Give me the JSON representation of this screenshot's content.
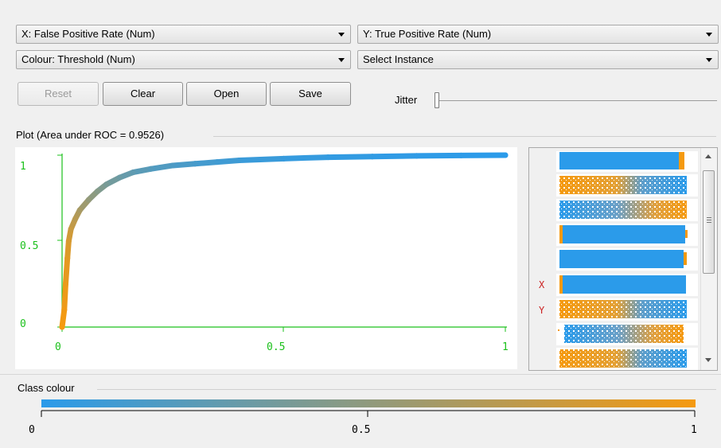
{
  "controls": {
    "x_axis": "X: False Positive Rate (Num)",
    "y_axis": "Y: True Positive Rate (Num)",
    "colour": "Colour: Threshold (Num)",
    "instance": "Select Instance",
    "reset": "Reset",
    "clear": "Clear",
    "open": "Open",
    "save": "Save",
    "jitter": "Jitter"
  },
  "plot": {
    "title": "Plot (Area under ROC = 0.9526)",
    "x_ticks": [
      "0",
      "0.5",
      "1"
    ],
    "y_ticks": [
      "0",
      "0.5",
      "1"
    ]
  },
  "side_panel": {
    "x_marker": "X",
    "y_marker": "Y"
  },
  "class_colour": {
    "title": "Class colour",
    "ticks": [
      "0",
      "0.5",
      "1"
    ],
    "gradient_start": "#2b9bea",
    "gradient_end": "#f59a10"
  },
  "chart_data": {
    "type": "scatter",
    "title": "Plot (Area under ROC = 0.9526)",
    "xlabel": "False Positive Rate",
    "ylabel": "True Positive Rate",
    "xlim": [
      0,
      1
    ],
    "ylim": [
      0,
      1
    ],
    "colour_by": "Threshold",
    "points": [
      [
        0.0,
        0.0
      ],
      [
        0.005,
        0.1
      ],
      [
        0.008,
        0.25
      ],
      [
        0.012,
        0.4
      ],
      [
        0.015,
        0.5
      ],
      [
        0.02,
        0.57
      ],
      [
        0.03,
        0.63
      ],
      [
        0.04,
        0.68
      ],
      [
        0.06,
        0.74
      ],
      [
        0.08,
        0.79
      ],
      [
        0.1,
        0.83
      ],
      [
        0.13,
        0.87
      ],
      [
        0.16,
        0.9
      ],
      [
        0.2,
        0.92
      ],
      [
        0.25,
        0.94
      ],
      [
        0.3,
        0.95
      ],
      [
        0.35,
        0.96
      ],
      [
        0.4,
        0.97
      ],
      [
        0.5,
        0.98
      ],
      [
        0.6,
        0.988
      ],
      [
        0.7,
        0.992
      ],
      [
        0.8,
        0.996
      ],
      [
        0.9,
        0.998
      ],
      [
        1.0,
        1.0
      ]
    ],
    "threshold": [
      1.0,
      0.98,
      0.95,
      0.9,
      0.85,
      0.78,
      0.7,
      0.62,
      0.52,
      0.45,
      0.38,
      0.32,
      0.26,
      0.21,
      0.17,
      0.14,
      0.11,
      0.09,
      0.06,
      0.04,
      0.03,
      0.02,
      0.01,
      0.0
    ]
  }
}
